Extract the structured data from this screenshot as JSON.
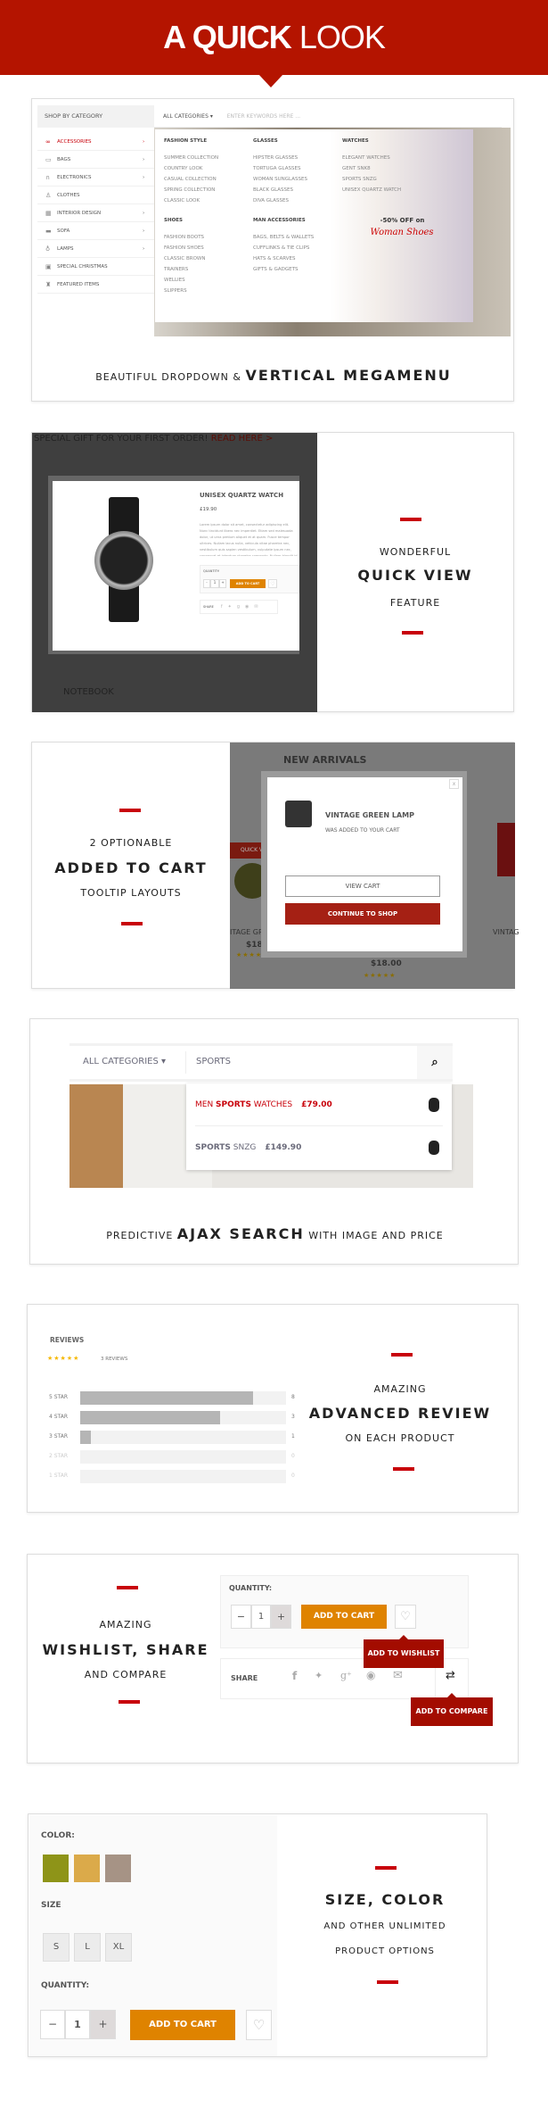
{
  "header": {
    "title_bold": "A QUICK",
    "title_light": "LOOK"
  },
  "colors": {
    "brand_red": "#b41400",
    "accent_red": "#c8000a",
    "orange": "#df8300",
    "tooltip_red": "#a30c00"
  },
  "megamenu": {
    "shop_by_category": "SHOP BY CATEGORY",
    "all_categories": "ALL CATEGORIES",
    "search_placeholder": "ENTER KEYWORDS HERE ...",
    "categories": [
      {
        "label": "ACCESSORIES",
        "icon": "glasses-icon",
        "arrow": true,
        "active": true
      },
      {
        "label": "BAGS",
        "icon": "bag-icon",
        "arrow": true
      },
      {
        "label": "ELECTRONICS",
        "icon": "headphones-icon",
        "arrow": true
      },
      {
        "label": "CLOTHES",
        "icon": "shirt-icon",
        "arrow": false
      },
      {
        "label": "INTERIOR DESIGN",
        "icon": "interior-icon",
        "arrow": true
      },
      {
        "label": "SOFA",
        "icon": "sofa-icon",
        "arrow": true
      },
      {
        "label": "LAMPS",
        "icon": "lamp-icon",
        "arrow": true
      },
      {
        "label": "SPECIAL CHRISTMAS",
        "icon": "gift-icon",
        "arrow": false
      },
      {
        "label": "FEATURED ITEMS",
        "icon": "trophy-icon",
        "arrow": false
      }
    ],
    "columns": [
      {
        "title": "FASHION STYLE",
        "items": [
          "SUMMER COLLECTION",
          "COUNTRY LOOK",
          "CASUAL COLLECTION",
          "SPRING COLLECTION",
          "CLASSIC LOOK"
        ]
      },
      {
        "title": "GLASSES",
        "items": [
          "HIPSTER GLASSES",
          "TORTUGA GLASSES",
          "WOMAN SUNGLASSES",
          "BLACK GLASSES",
          "DIVA GLASSES"
        ]
      },
      {
        "title": "WATCHES",
        "items": [
          "ELEGANT WATCHES",
          "GENT SNK8",
          "SPORTS SNZG",
          "UNISEX QUARTZ WATCH"
        ]
      },
      {
        "title": "SHOES",
        "items": [
          "FASHION BOOTS",
          "FASHION SHOES",
          "CLASSIC BROWN",
          "TRAINERS",
          "WELLIES",
          "SLIPPERS"
        ]
      },
      {
        "title": "MAN ACCESSORIES",
        "items": [
          "BAGS, BELTS & WALLETS",
          "CUFFLINKS & TIE CLIPS",
          "HATS & SCARVES",
          "GIFTS & GADGETS"
        ]
      }
    ],
    "promo_line1": "-50% OFF on",
    "promo_line2": "Woman Shoes",
    "caption_light": "BEAUTIFUL DROPDOWN &",
    "caption_bold": "VERTICAL MEGAMENU"
  },
  "quickview": {
    "topbar": "SPECIAL GIFT FOR YOUR FIRST ORDER!",
    "topbar_link": "READ HERE >",
    "bg_item": "NOTEBOOK",
    "product_name": "UNISEX QUARTZ WATCH",
    "price": "£19.90",
    "description": "Lorem ipsum dolor sit amet, consectetur adipiscing elit. Nunc tincidunt libero nec imperdiet. Etiam sed malesuada dolor, ut urna pretium aliquet et at quam. Fusce tempor ultrices. Nullam lacus nulla, vehicula vitae pharetra nec, vestibulum quis sapien vestibulum, vulputate ipsum nec, consequat et interdum pharetra commodo. Nullam blandit id neque.",
    "quantity_label": "QUANTITY:",
    "qty": "1",
    "minus": "-",
    "plus": "+",
    "add_to_cart": "ADD TO CART",
    "share": "SHARE",
    "line1": "WONDERFUL",
    "line2": "QUICK VIEW",
    "line3": "FEATURE"
  },
  "addedcart": {
    "line1": "2 OPTIONABLE",
    "line2": "ADDED TO CART",
    "line3": "TOOLTIP LAYOUTS",
    "bg_title": "NEW ARRIVALS",
    "bg_quick": "QUICK VI",
    "bg_name1": "ITAGE GRE",
    "bg_price1": "$18.00",
    "bg_price2": "$18.00",
    "bg_name3": "VINTAG",
    "close": "x",
    "product": "VINTAGE GREEN LAMP",
    "message": "WAS ADDED TO YOUR CART",
    "view_cart": "VIEW CART",
    "continue": "CONTINUE TO SHOP"
  },
  "ajax": {
    "all_categories": "ALL CATEGORIES",
    "query": "SPORTS",
    "results": [
      {
        "name_pre": "MEN ",
        "name_bold": "SPORTS",
        "name_post": " WATCHES",
        "price": "£79.00",
        "highlight": true
      },
      {
        "name_pre": "",
        "name_bold": "SPORTS",
        "name_post": " SNZG",
        "price": "£149.90",
        "highlight": false
      }
    ],
    "caption_pre": "PREDICTIVE",
    "caption_bold": "AJAX SEARCH",
    "caption_post": "WITH IMAGE AND PRICE"
  },
  "reviews": {
    "title": "REVIEWS",
    "rating": 5,
    "count_label": "3 REVIEWS",
    "rows": [
      {
        "label": "5 STAR",
        "count": "8",
        "fill": 0.84
      },
      {
        "label": "4 STAR",
        "count": "3",
        "fill": 0.68
      },
      {
        "label": "3 STAR",
        "count": "1",
        "fill": 0.05
      },
      {
        "label": "2 STAR",
        "count": "0",
        "fill": 0
      },
      {
        "label": "1 STAR",
        "count": "0",
        "fill": 0
      }
    ],
    "line1": "AMAZING",
    "line2": "ADVANCED REVIEW",
    "line3": "ON EACH PRODUCT"
  },
  "wishlist": {
    "line1": "AMAZING",
    "line2": "WISHLIST, SHARE",
    "line3": "AND COMPARE",
    "quantity_label": "QUANTITY:",
    "qty": "1",
    "minus": "−",
    "plus": "+",
    "add_to_cart": "ADD TO CART",
    "share": "SHARE",
    "tip_wishlist": "ADD TO WISHLIST",
    "tip_compare": "ADD TO COMPARE"
  },
  "options": {
    "color_label": "COLOR:",
    "swatches": [
      "#8e9418",
      "#dbaa4a",
      "#a69385"
    ],
    "size_label": "SIZE",
    "sizes": [
      "S",
      "L",
      "XL"
    ],
    "quantity_label": "QUANTITY:",
    "qty": "1",
    "minus": "−",
    "plus": "+",
    "add_to_cart": "ADD TO CART",
    "line1": "SIZE, COLOR",
    "line2": "AND OTHER UNLIMITED",
    "line3": "PRODUCT OPTIONS"
  }
}
